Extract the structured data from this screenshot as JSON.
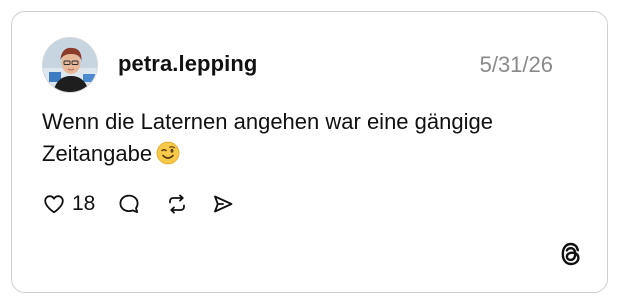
{
  "post": {
    "username": "petra.lepping",
    "date": "5/31/26",
    "text": "Wenn die Laternen angehen war eine gängige Zeitangabe",
    "emoji": "winking-face",
    "like_count": "18"
  },
  "icons": {
    "like": "heart-icon",
    "comment": "comment-bubble-icon",
    "repost": "repost-icon",
    "share": "send-icon",
    "brand": "threads-logo-icon"
  },
  "colors": {
    "text": "#111111",
    "muted": "#8a8a8a",
    "border": "#cfcfcf",
    "emoji": "#f7c948"
  }
}
